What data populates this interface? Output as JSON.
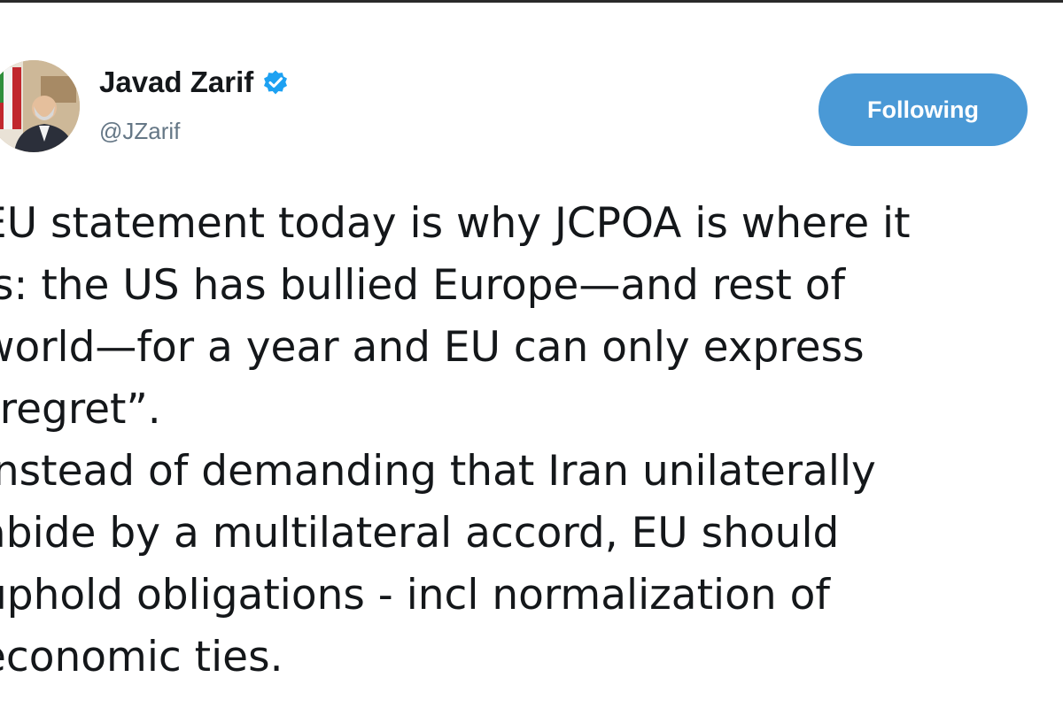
{
  "tweet": {
    "author": {
      "display_name": "Javad Zarif",
      "handle": "@JZarif",
      "verified": true,
      "avatar_icon": "profile-photo"
    },
    "follow_button": {
      "label": "Following",
      "color": "#4a99d6"
    },
    "text_lines": [
      "EU statement today is why JCPOA is where it",
      "is: the US has bullied Europe—and rest of",
      "world—for a year and EU can only express",
      "“regret”.",
      "Instead of demanding that Iran unilaterally",
      "abide by a multilateral accord, EU should",
      "uphold obligations - incl normalization of",
      "economic ties."
    ]
  },
  "colors": {
    "accent": "#1da1f2",
    "text": "#14171a",
    "muted": "#657786"
  },
  "icons": [
    "verified-badge-icon"
  ]
}
